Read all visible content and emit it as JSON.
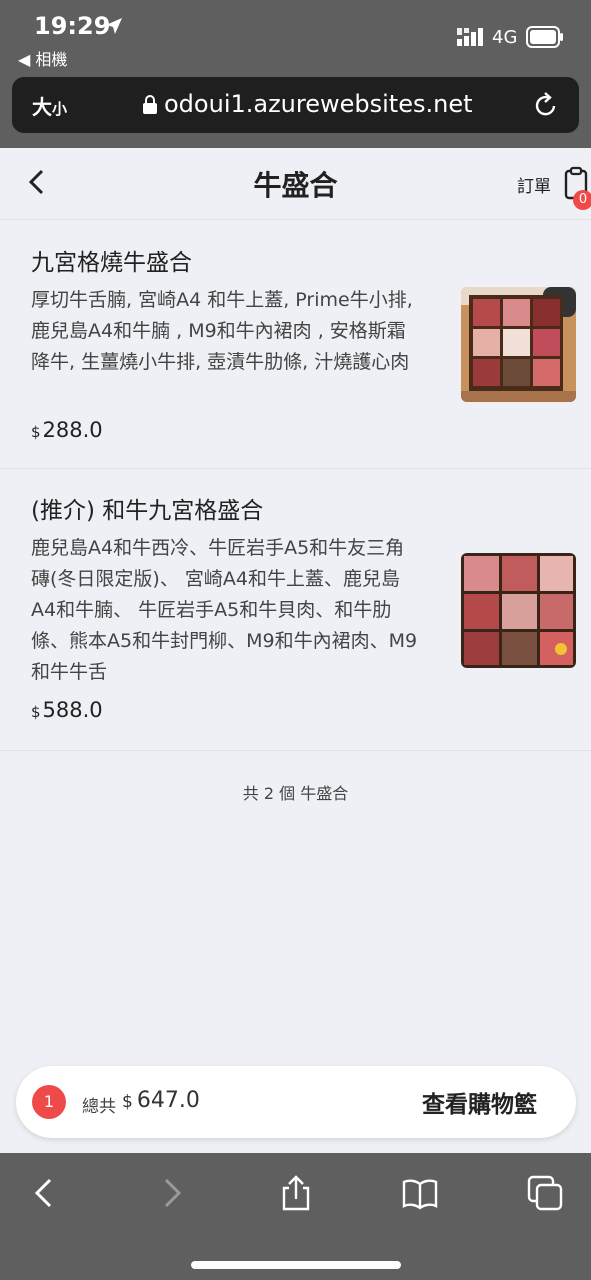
{
  "status": {
    "time": "19:29",
    "back_app": "◀ 相機",
    "network": "4G"
  },
  "browser": {
    "text_size": "大",
    "text_size_small": "小",
    "url": "odoui1.azurewebsites.net"
  },
  "header": {
    "title": "牛盛合",
    "orders_label": "訂單",
    "orders_count": "0"
  },
  "items": [
    {
      "name": "九宮格燒牛盛合",
      "description": "厚切牛舌腩, 宮崎A4 和牛上蓋, Prime牛小排, 鹿兒島A4和牛腩 , M9和牛內裙肉 , 安格斯霜降牛, 生薑燒小牛排, 壺漬牛肋條, 汁燒護心肉",
      "currency": "$",
      "price": "288.0"
    },
    {
      "name": "(推介) 和牛九宮格盛合",
      "description": "鹿兒島A4和牛西冷、牛匠岩手A5和牛友三角磚(冬日限定版)、 宮崎A4和牛上蓋、鹿兒島A4和牛腩、 牛匠岩手A5和牛貝肉、和牛肋條、熊本A5和牛封門柳、M9和牛內裙肉、M9和牛牛舌",
      "currency": "$",
      "price": "588.0"
    }
  ],
  "count_text": "共 2 個 牛盛合",
  "cart": {
    "count": "1",
    "total_label": "總共",
    "currency": "$",
    "total": "647.0",
    "button_label": "查看購物籃"
  },
  "colors": {
    "accent_red": "#ef4a4a",
    "page_bg": "#eef0f5",
    "chrome": "#5f5f5f"
  }
}
